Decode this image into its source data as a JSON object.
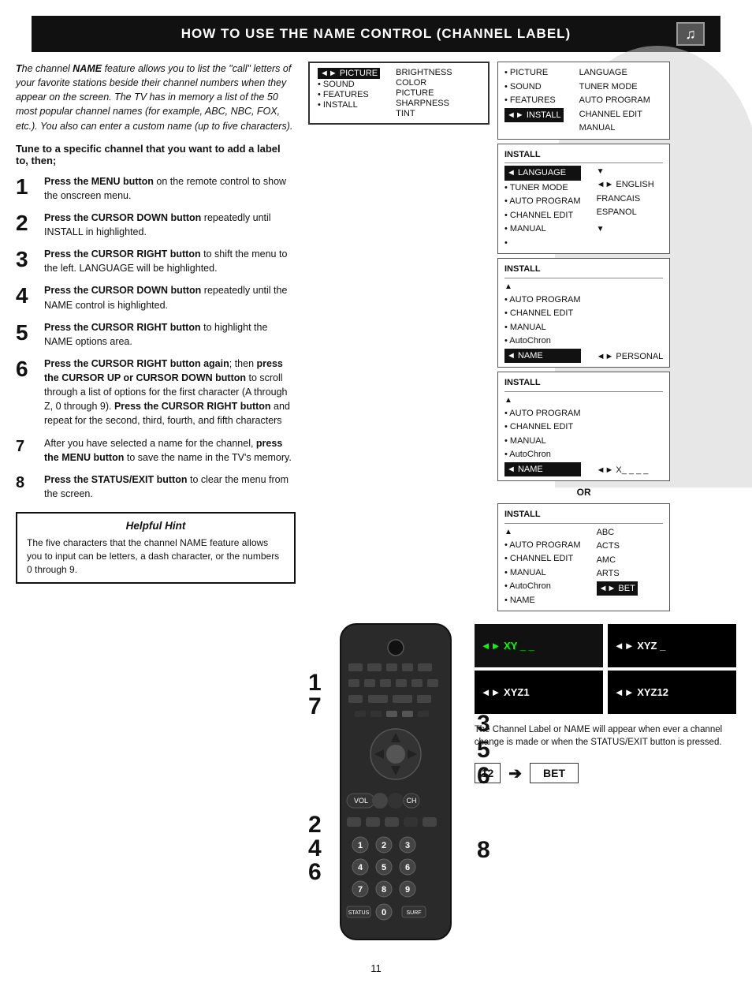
{
  "header": {
    "title": "How to Use the Name Control (Channel Label)"
  },
  "intro": {
    "text": "The channel NAME feature allows you to list the \"call\" letters of your favorite stations beside their channel numbers when they appear on the screen. The TV has in memory a list of the 50 most popular channel names (for example, ABC, NBC, FOX, etc.). You also can enter a custom name (up to five characters)."
  },
  "tune_heading": "Tune to a specific channel that you want to add a label to, then;",
  "steps": [
    {
      "num": "1",
      "text": "Press the MENU button on the remote control to show the onscreen menu."
    },
    {
      "num": "2",
      "text": "Press the CURSOR DOWN button repeatedly until INSTALL in highlighted."
    },
    {
      "num": "3",
      "text": "Press the CURSOR RIGHT button to shift the menu to the left. LANGUAGE will be highlighted."
    },
    {
      "num": "4",
      "text": "Press the CURSOR DOWN button repeatedly until the NAME control is highlighted."
    },
    {
      "num": "5",
      "text": "Press the CURSOR RIGHT button to highlight the NAME options area."
    },
    {
      "num": "6",
      "text": "Press the CURSOR RIGHT button again; then press the CURSOR UP or CURSOR DOWN button to scroll through a list of options for the first character (A through Z, 0 through 9). Press the CURSOR RIGHT button and repeat for the second, third, fourth, and fifth characters"
    },
    {
      "num": "7",
      "text": "After you have selected a name for the channel, press the MENU button to save the name in the TV's memory."
    },
    {
      "num": "8",
      "text": "Press the STATUS/EXIT button to clear the menu from the screen."
    }
  ],
  "helpful_hint": {
    "title": "Helpful Hint",
    "text": "The five characters that the channel NAME feature allows you to input can be letters, a dash character, or the numbers 0 through 9."
  },
  "menu_panel1": {
    "title": "",
    "items": [
      "• PICTURE",
      "• SOUND",
      "• FEATURES",
      "• INSTALL"
    ],
    "right_items": [
      "BRIGHTNESS",
      "COLOR",
      "PICTURE",
      "SHARPNESS",
      "TINT"
    ],
    "highlighted": "• PICTURE"
  },
  "menu_panel2": {
    "title": "",
    "items": [
      "• PICTURE",
      "• SOUND",
      "• FEATURES",
      "◄► INSTALL"
    ],
    "right_items": [
      "LANGUAGE",
      "TUNER MODE",
      "AUTO PROGRAM",
      "CHANNEL EDIT",
      "MANUAL"
    ],
    "highlighted": "◄► INSTALL"
  },
  "menu_panel3": {
    "title": "INSTALL",
    "items": [
      "◄ LANGUAGE",
      "• TUNER MODE",
      "• AUTO PROGRAM",
      "• CHANNEL EDIT",
      "• MANUAL",
      "•"
    ],
    "right_items": [
      "◄► ENGLISH",
      "FRANCAIS",
      "ESPANOL"
    ],
    "highlighted": "◄ LANGUAGE"
  },
  "menu_panel4": {
    "title": "INSTALL",
    "items": [
      "•",
      "• AUTO PROGRAM",
      "• CHANNEL EDIT",
      "• MANUAL",
      "• AutoChron",
      "◄ NAME"
    ],
    "right_items": [
      "◄► PERSONAL"
    ],
    "highlighted": "◄ NAME"
  },
  "menu_panel5": {
    "title": "INSTALL",
    "items": [
      "•",
      "• AUTO PROGRAM",
      "• CHANNEL EDIT",
      "• MANUAL",
      "• AutoChron",
      "◄ NAME"
    ],
    "right_items": [
      "◄► X_ _ _ _"
    ],
    "highlighted": "◄ NAME"
  },
  "menu_panel6": {
    "title": "INSTALL",
    "items": [
      "•",
      "• AUTO PROGRAM",
      "• CHANNEL EDIT",
      "• MANUAL",
      "• AutoChron",
      "• NAME"
    ],
    "right_items": [
      "ABC",
      "ACTS",
      "AMC",
      "ARTS",
      "◄► BET"
    ],
    "highlighted": "◄► BET"
  },
  "screens": [
    {
      "text": "◄► XY _ _"
    },
    {
      "text": "◄► XYZ _"
    },
    {
      "text": "◄► XYZ1"
    },
    {
      "text": "◄► XYZ12"
    }
  ],
  "bottom_caption": "The Channel Label or NAME will appear when ever a channel change is made or when the STATUS/EXIT button is pressed.",
  "channel_display": {
    "num": "12",
    "name": "BET"
  },
  "page_number": "11",
  "side_numbers": [
    "1",
    "7",
    "2",
    "4",
    "6",
    "3",
    "5",
    "6",
    "8"
  ],
  "or_label": "OR"
}
